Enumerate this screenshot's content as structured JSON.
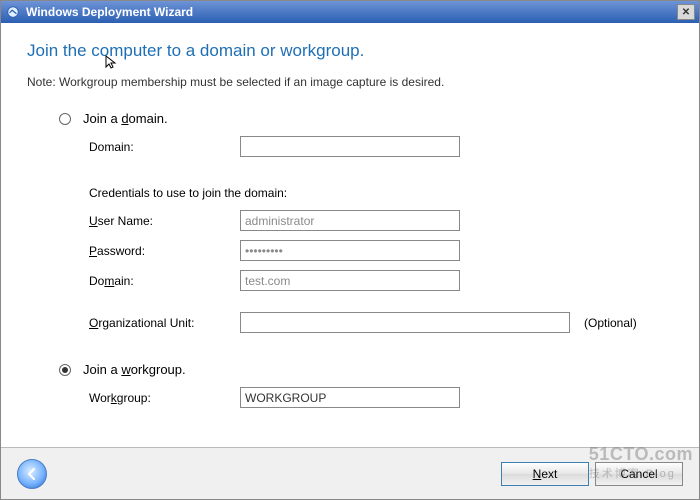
{
  "window": {
    "title": "Windows Deployment Wizard"
  },
  "heading": "Join the computer to a domain or workgroup.",
  "note": "Note: Workgroup membership must be selected if an image capture is desired.",
  "domain_option": {
    "label_pre": "Join a ",
    "label_u": "d",
    "label_post": "omain.",
    "selected": false,
    "domain_label": "Domain:",
    "domain_value": "",
    "creds_label": "Credentials to use to join the domain:",
    "username_label_pre": "",
    "username_label_u": "U",
    "username_label_post": "ser Name:",
    "username_value": "administrator",
    "password_label_pre": "",
    "password_label_u": "P",
    "password_label_post": "assword:",
    "password_value": "•••••••••",
    "cred_domain_label_pre": "Do",
    "cred_domain_label_u": "m",
    "cred_domain_label_post": "ain:",
    "cred_domain_value": "test.com",
    "ou_label_pre": "",
    "ou_label_u": "O",
    "ou_label_post": "rganizational Unit:",
    "ou_value": "",
    "optional": "(Optional)"
  },
  "workgroup_option": {
    "label_pre": "Join a ",
    "label_u": "w",
    "label_post": "orkgroup.",
    "selected": true,
    "workgroup_label_pre": "Wor",
    "workgroup_label_u": "k",
    "workgroup_label_post": "group:",
    "workgroup_value": "WORKGROUP"
  },
  "footer": {
    "next_label_pre": "",
    "next_label_u": "N",
    "next_label_post": "ext",
    "cancel": "Cancel"
  },
  "watermark": {
    "main": "51CTO.com",
    "sub": "技术博客    Blog"
  }
}
